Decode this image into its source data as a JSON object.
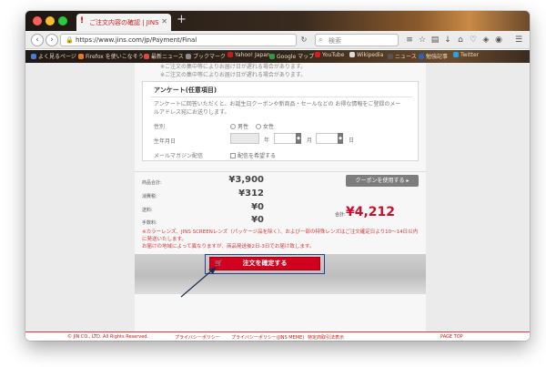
{
  "browser": {
    "tab_title": "ご注文内容の確認 | JINS",
    "url": "https://www.jins.com/jp/Payment/Final",
    "search_placeholder": "検索",
    "bookmarks": [
      {
        "label": "よく見るページ",
        "color": "#4a7bd1"
      },
      {
        "label": "Firefox を使いこなそう",
        "color": "#e8782a"
      },
      {
        "label": "最新ニュース",
        "color": "#d94a3a"
      },
      {
        "label": "ブックマーク",
        "color": "#8c8c8c"
      },
      {
        "label": "Yahoo! Japan",
        "color": "#c41c1c"
      },
      {
        "label": "Google マップ",
        "color": "#2e9b44"
      },
      {
        "label": "YouTube",
        "color": "#d91c1c"
      },
      {
        "label": "Wikipedia",
        "color": "#dddddd"
      },
      {
        "label": "ニュース",
        "color": "#555555"
      },
      {
        "label": "勉強記事",
        "color": "#2a62b8"
      },
      {
        "label": "Twitter",
        "color": "#2aa3e6"
      }
    ]
  },
  "page": {
    "note_top": "※ご注文の集中等によりお届け日が遅れる場合があります。\n※ご注文の集中等によりお届け日が遅れる場合があります。",
    "survey": {
      "title": "アンケート(任意項目)",
      "description": "アンケートに回答いただくと、お誕生日クーポンや新商品・セールなどの お得な情報をご登録のメールアドレス宛にお送りします。",
      "gender_label": "性別",
      "gender_options": [
        "男性",
        "女性"
      ],
      "birthday_label": "生年月日",
      "year_unit": "年",
      "month_unit": "月",
      "day_unit": "日",
      "newsletter_label": "メールマガジン配信",
      "newsletter_option": "配信を希望する"
    },
    "summary": {
      "rows": [
        {
          "label": "商品合計:",
          "value": "¥3,900"
        },
        {
          "label": "消費税:",
          "value": "¥312"
        },
        {
          "label": "送料:",
          "value": "¥0"
        },
        {
          "label": "手数料:",
          "value": "¥0"
        }
      ],
      "coupon_button": "クーポンを使用する",
      "total_label": "合計:",
      "total_value": "¥4,212"
    },
    "notice": "※カラーレンズ、JINS SCREENレンズ（パッケージ品を除く）、および一部の特殊レンズはご注文確定日より10〜14日以内に発送いたします。\nお届けの地域によって異なりますが、商品発送後2日-3日でお届け致します。",
    "confirm_button": "注文を確定する",
    "footer": {
      "copyright": "© JIN CO., LTD. All Rights Reserved.",
      "links": [
        "プライバシーポリシー",
        "プライバシーポリシー(JINS MEME)",
        "特定商取引法表示"
      ],
      "page_top": "PAGE TOP"
    }
  }
}
